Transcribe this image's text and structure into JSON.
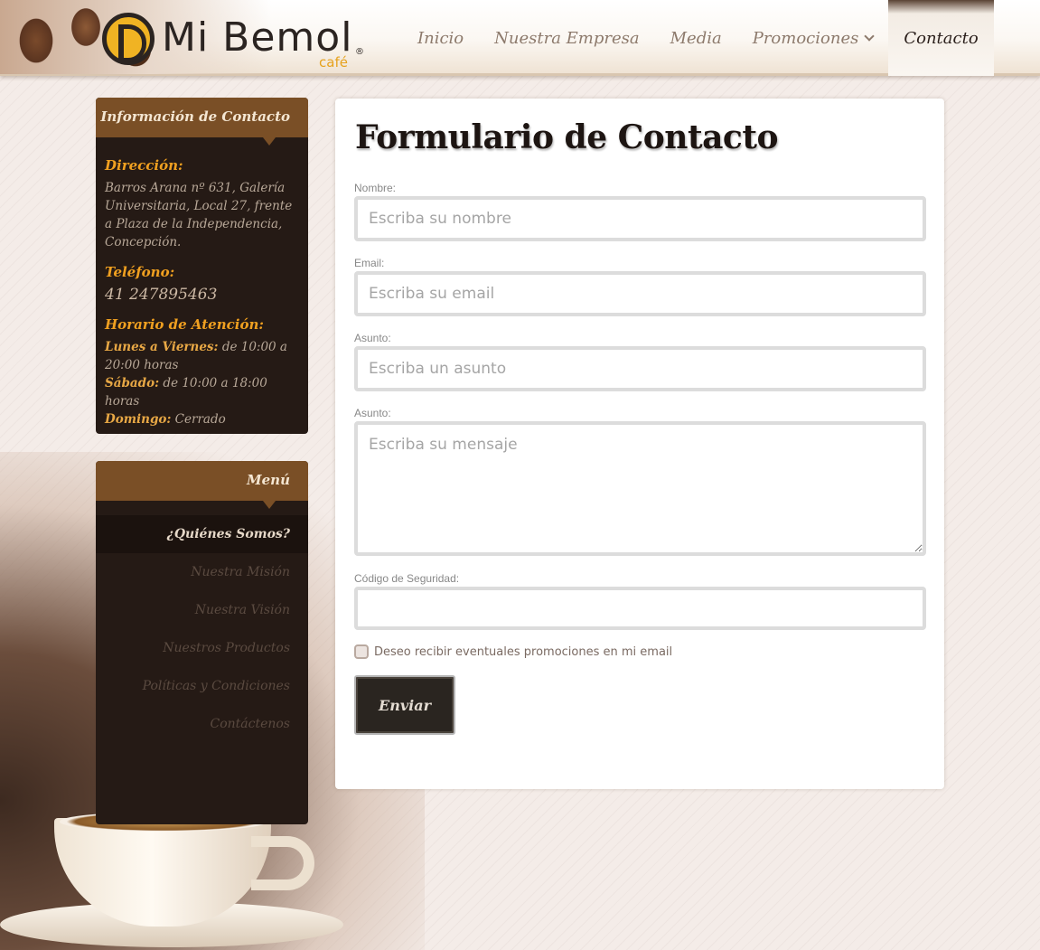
{
  "header": {
    "logo_text": "Mi Bemol",
    "logo_sub": "café",
    "logo_reg": "®",
    "nav": [
      {
        "label": "Inicio"
      },
      {
        "label": "Nuestra Empresa"
      },
      {
        "label": "Media"
      },
      {
        "label": "Promociones"
      },
      {
        "label": "Contacto"
      }
    ]
  },
  "contact_info": {
    "heading": "Información de Contacto",
    "address_label": "Dirección:",
    "address": "Barros Arana nº 631, Galería Universitaria, Local 27, frente a Plaza de la Independencia, Concepción.",
    "phone_label": "Teléfono:",
    "phone": "41 247895463",
    "hours_label": "Horario de Atención:",
    "hours": [
      {
        "day": "Lunes a Viernes:",
        "time": "de 10:00 a 20:00 horas"
      },
      {
        "day": "Sábado:",
        "time": "de 10:00 a 18:00 horas"
      },
      {
        "day": "Domingo:",
        "time": "Cerrado"
      }
    ]
  },
  "menu": {
    "heading": "Menú",
    "items": [
      {
        "label": "¿Quiénes Somos?"
      },
      {
        "label": "Nuestra Misión"
      },
      {
        "label": "Nuestra Visión"
      },
      {
        "label": "Nuestros Productos"
      },
      {
        "label": "Políticas y Condiciones"
      },
      {
        "label": "Contáctenos"
      }
    ]
  },
  "form": {
    "title": "Formulario de Contacto",
    "name_label": "Nombre:",
    "name_placeholder": "Escriba su nombre",
    "email_label": "Email:",
    "email_placeholder": "Escriba su email",
    "subject_label": "Asunto:",
    "subject_placeholder": "Escriba un asunto",
    "message_label": "Asunto:",
    "message_placeholder": "Escriba su mensaje",
    "captcha_label": "Código de Seguridad:",
    "captcha_value": "",
    "promo_checkbox_label": "Deseo recibir eventuales promociones en mi email",
    "submit_label": "Enviar"
  }
}
